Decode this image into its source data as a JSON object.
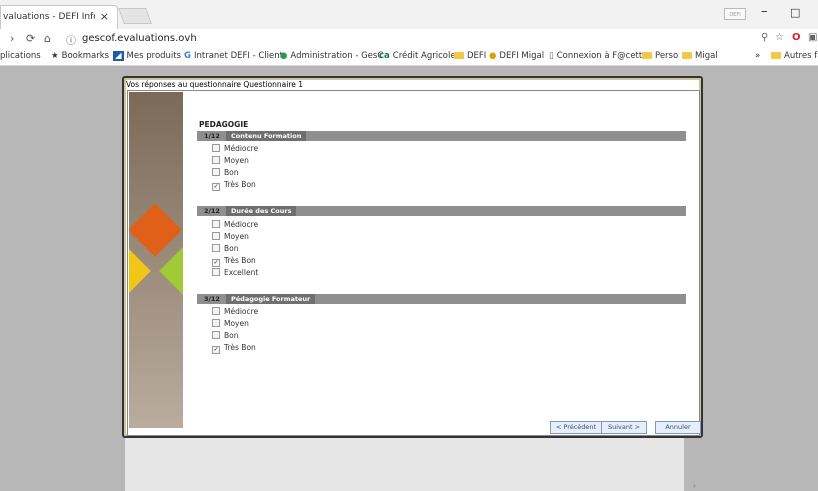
{
  "browser": {
    "tab_title": "valuations - DEFI Inform",
    "tab_close": "×",
    "window_label": "DEFI",
    "minimize": "–",
    "restore": "□",
    "url": "gescof.evaluations.ovh"
  },
  "bookmarks": [
    {
      "label": "plications",
      "kind": "none"
    },
    {
      "label": "Bookmarks",
      "kind": "star"
    },
    {
      "label": "Mes produits",
      "kind": "app"
    },
    {
      "label": "Intranet DEFI - Client",
      "kind": "g"
    },
    {
      "label": "Administration - GesC",
      "kind": "globe"
    },
    {
      "label": "Crédit Agricole",
      "kind": "ca"
    },
    {
      "label": "DEFI",
      "kind": "folder"
    },
    {
      "label": "DEFI Migal",
      "kind": "globe"
    },
    {
      "label": "Connexion à F@cett",
      "kind": "page"
    },
    {
      "label": "Perso",
      "kind": "folder"
    },
    {
      "label": "Migal",
      "kind": "folder"
    },
    {
      "label": "»",
      "kind": "none"
    },
    {
      "label": "Autres fa",
      "kind": "folder"
    }
  ],
  "dialog": {
    "title": "Vos réponses au questionnaire Questionnaire 1",
    "section": "PEDAGOGIE",
    "questions": [
      {
        "num": "1/12",
        "title": "Contenu Formation",
        "options": [
          {
            "label": "Médiocre",
            "checked": false
          },
          {
            "label": "Moyen",
            "checked": false
          },
          {
            "label": "Bon",
            "checked": false
          },
          {
            "label": "Très Bon",
            "checked": true
          }
        ]
      },
      {
        "num": "2/12",
        "title": "Durée des Cours",
        "options": [
          {
            "label": "Médiocre",
            "checked": false
          },
          {
            "label": "Moyen",
            "checked": false
          },
          {
            "label": "Bon",
            "checked": false
          },
          {
            "label": "Très Bon",
            "checked": true
          },
          {
            "label": "Excellent",
            "checked": false
          }
        ]
      },
      {
        "num": "3/12",
        "title": "Pédagogie Formateur",
        "options": [
          {
            "label": "Médiocre",
            "checked": false
          },
          {
            "label": "Moyen",
            "checked": false
          },
          {
            "label": "Bon",
            "checked": false
          },
          {
            "label": "Très Bon",
            "checked": true
          }
        ]
      }
    ],
    "buttons": {
      "previous": "< Précédent",
      "next": "Suivant >",
      "cancel": "Annuler"
    }
  }
}
